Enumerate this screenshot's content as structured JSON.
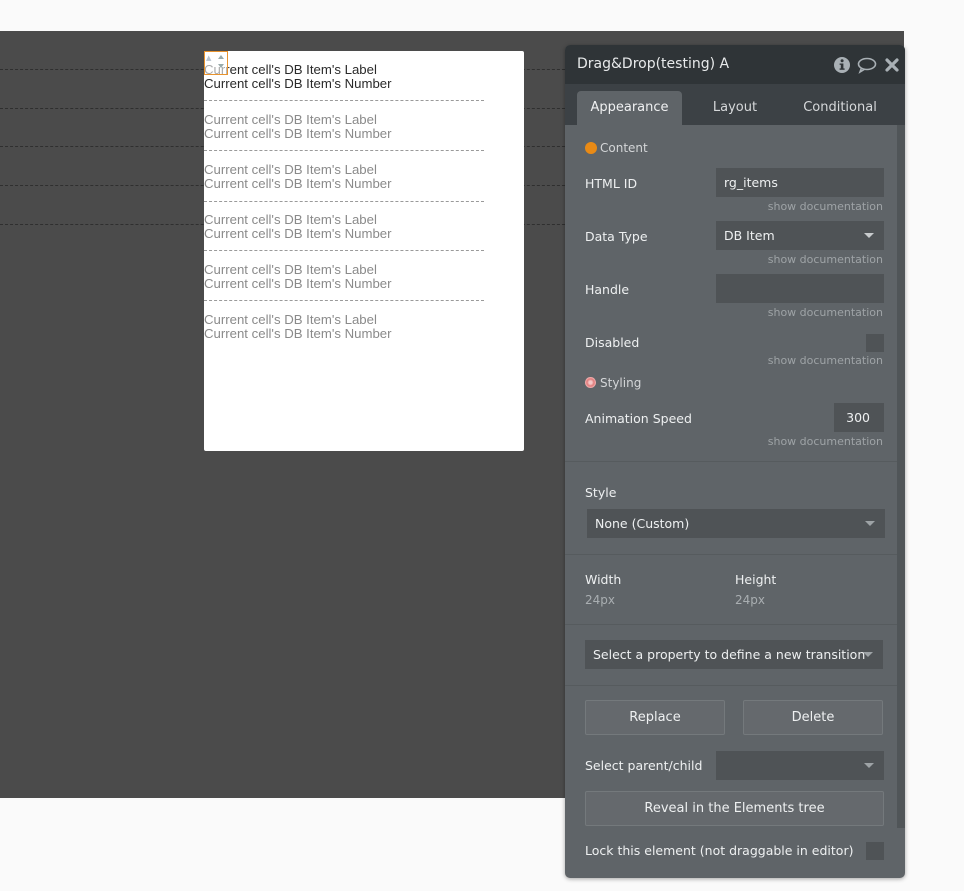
{
  "canvas": {
    "repeating_group": {
      "cells": [
        {
          "label": "Current cell's DB Item's Label",
          "number": "Current cell's DB Item's Number"
        },
        {
          "label": "Current cell's DB Item's Label",
          "number": "Current cell's DB Item's Number"
        },
        {
          "label": "Current cell's DB Item's Label",
          "number": "Current cell's DB Item's Number"
        },
        {
          "label": "Current cell's DB Item's Label",
          "number": "Current cell's DB Item's Number"
        },
        {
          "label": "Current cell's DB Item's Label",
          "number": "Current cell's DB Item's Number"
        },
        {
          "label": "Current cell's DB Item's Label",
          "number": "Current cell's DB Item's Number"
        }
      ]
    },
    "selected_element_color": "#e8932e"
  },
  "panel": {
    "title": "Drag&Drop(testing) A",
    "header_icons": [
      "info-icon",
      "comment-icon",
      "close-icon"
    ],
    "tabs": [
      {
        "label": "Appearance",
        "active": true
      },
      {
        "label": "Layout",
        "active": false
      },
      {
        "label": "Conditional",
        "active": false
      }
    ],
    "content_section": {
      "title": "Content",
      "icon": "orange-icon"
    },
    "fields": {
      "html_id": {
        "label": "HTML ID",
        "value": "rg_items",
        "doc": "show documentation"
      },
      "data_type": {
        "label": "Data Type",
        "value": "DB Item",
        "doc": "show documentation"
      },
      "handle": {
        "label": "Handle",
        "value": "",
        "doc": "show documentation"
      },
      "disabled": {
        "label": "Disabled",
        "checked": false,
        "doc": "show documentation"
      }
    },
    "styling_section": {
      "title": "Styling",
      "icon": "lollipop-icon"
    },
    "animation_speed": {
      "label": "Animation Speed",
      "value": "300",
      "doc": "show documentation"
    },
    "style": {
      "label": "Style",
      "value": "None (Custom)"
    },
    "width": {
      "label": "Width",
      "value": "24px"
    },
    "height": {
      "label": "Height",
      "value": "24px"
    },
    "transition": {
      "placeholder": "Select a property to define a new transition"
    },
    "buttons": {
      "replace": "Replace",
      "delete": "Delete",
      "reveal": "Reveal in the Elements tree"
    },
    "parent_child": {
      "label": "Select parent/child",
      "value": ""
    },
    "lock": {
      "label": "Lock this element (not draggable in editor)",
      "checked": false
    }
  }
}
